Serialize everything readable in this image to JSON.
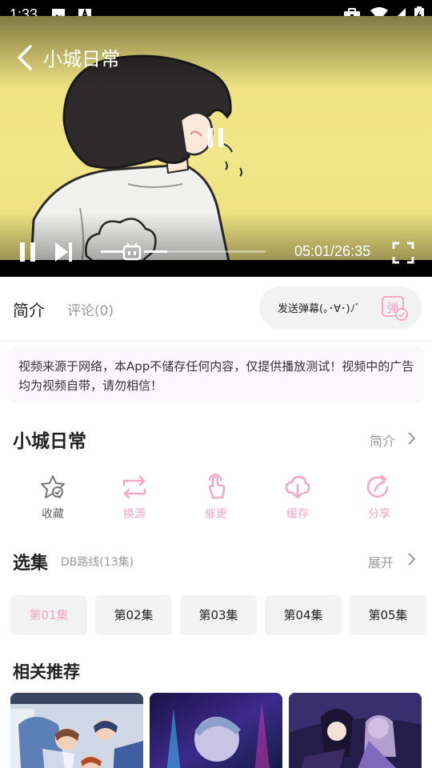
{
  "status_bar": {
    "time": "1:33",
    "icons": [
      "image-icon",
      "a-notification-icon",
      "briefcase-icon",
      "wifi-icon",
      "signal-icon",
      "battery-charging-icon"
    ]
  },
  "player": {
    "title": "小城日常",
    "time_current": "05:01",
    "time_total": "26:35",
    "time_display": "05:01/26:35",
    "progress": 0.19
  },
  "tabs": {
    "intro": "简介",
    "comments": "评论(0)"
  },
  "danmaku": {
    "placeholder": "发送弹幕(｡･∀･)ﾉﾞ",
    "icon_text": "弹"
  },
  "notice": "视频来源于网络，本App不储存任何内容，仅提供播放测试！视频中的广告均为视频自带，请勿相信！",
  "show": {
    "title": "小城日常",
    "intro_link": "简介"
  },
  "actions": [
    {
      "label": "收藏",
      "icon": "star-icon"
    },
    {
      "label": "换源",
      "icon": "switch-source-icon"
    },
    {
      "label": "催更",
      "icon": "urge-update-icon"
    },
    {
      "label": "缓存",
      "icon": "cloud-download-icon"
    },
    {
      "label": "分享",
      "icon": "share-icon"
    }
  ],
  "episodes": {
    "title": "选集",
    "route": "DB路线(13集)",
    "expand": "展开",
    "items": [
      "第01集",
      "第02集",
      "第03集",
      "第04集",
      "第05集"
    ],
    "selected_index": 0
  },
  "recommend": {
    "title": "相关推荐"
  },
  "colors": {
    "accent_pink": "#f2a7c2",
    "video_bg": "#ece07a",
    "muted_text": "#999999"
  }
}
